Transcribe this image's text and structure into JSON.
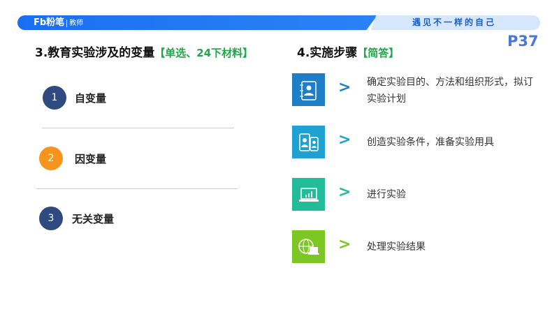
{
  "header": {
    "logo": "Fb粉笔",
    "logo_sub": "教师",
    "slogan": "遇见不一样的自己",
    "page": "P37"
  },
  "left": {
    "title": "3.教育实验涉及的变量",
    "tag": "【单选、24下材料】",
    "items": [
      {
        "num": "1",
        "label": "自变量",
        "color": "#2f4a7e"
      },
      {
        "num": "2",
        "label": "因变量",
        "color": "#f7941d"
      },
      {
        "num": "3",
        "label": "无关变量",
        "color": "#2f4a7e"
      }
    ]
  },
  "right": {
    "title": "4.实施步骤",
    "tag": "【简答】",
    "steps": [
      {
        "text": "确定实验目的、方法和组织形式，拟订实验计划",
        "icon": "contacts-book-icon",
        "color": "#1e7fc8"
      },
      {
        "text": "创造实验条件，准备实验用具",
        "icon": "mobile-users-icon",
        "color": "#1fa1d2"
      },
      {
        "text": "进行实验",
        "icon": "laptop-chart-icon",
        "color": "#22bc9a"
      },
      {
        "text": "处理实验结果",
        "icon": "globe-computer-icon",
        "color": "#7cc723"
      }
    ],
    "arrow": ">"
  }
}
